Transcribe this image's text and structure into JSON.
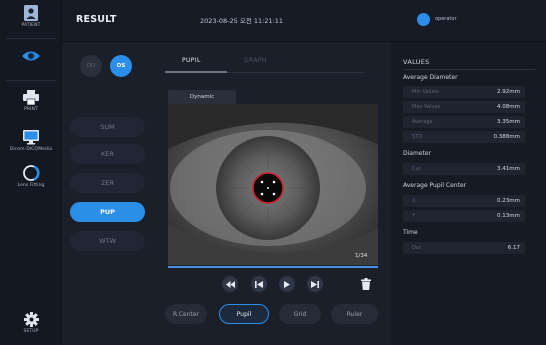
{
  "nav": {
    "patient_label": "PATIENT",
    "eye_label": "",
    "print_label": "PRINT",
    "dicom_label": "Dicom-DICOMedia",
    "lens_label": "Lens Fitting",
    "setup_label": "SETUP"
  },
  "header": {
    "title": "RESULT",
    "datetime": "2023-08-25 오전 11:21:11",
    "user": "operator"
  },
  "eye_select": {
    "od": "OD",
    "os": "OS",
    "selected": "OS"
  },
  "modes": [
    {
      "label": "SUM",
      "active": false
    },
    {
      "label": "KER",
      "active": false
    },
    {
      "label": "ZER",
      "active": false
    },
    {
      "label": "PUP",
      "active": true
    },
    {
      "label": "WTW",
      "active": false
    }
  ],
  "tabs": {
    "pupil": "PUPIL",
    "graph": "GRAPH"
  },
  "subtab": "Dynamic",
  "viewer": {
    "frame": "1/34",
    "progress": 1.0
  },
  "tools": [
    "R.Center",
    "Pupil",
    "Grid",
    "Ruler"
  ],
  "values": {
    "title": "VALUES",
    "average_diameter_title": "Average Diameter",
    "average_diameter": [
      {
        "k": "Min Values",
        "v": "2.92mm"
      },
      {
        "k": "Max Values",
        "v": "4.08mm"
      },
      {
        "k": "Average",
        "v": "3.35mm"
      },
      {
        "k": "STD",
        "v": "0.388mm"
      }
    ],
    "diameter_title": "Diameter",
    "diameter": [
      {
        "k": "Cur",
        "v": "3.41mm"
      }
    ],
    "pupil_center_title": "Average Pupil Center",
    "pupil_center": [
      {
        "k": "X",
        "v": "0.23mm"
      },
      {
        "k": "Y",
        "v": "0.13mm"
      }
    ],
    "time_title": "Time",
    "time": [
      {
        "k": "Dur.",
        "v": "6.17"
      }
    ]
  },
  "colors": {
    "accent": "#2b8ee8",
    "bg": "#1a1f2a",
    "panel": "#151a23"
  }
}
